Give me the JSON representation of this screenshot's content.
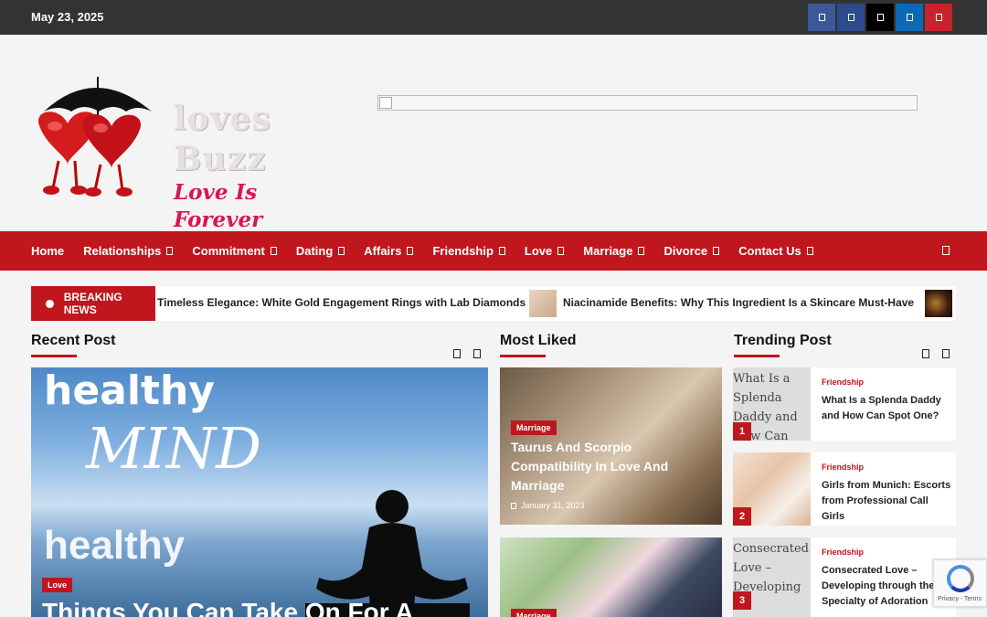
{
  "topbar": {
    "date": "May 23, 2025"
  },
  "socials": [
    {
      "icon": "facebook-icon",
      "color": "#3b5998"
    },
    {
      "icon": "vk-icon",
      "color": "#2d4a8a"
    },
    {
      "icon": "x-twitter-icon",
      "color": "#000000"
    },
    {
      "icon": "linkedin-icon",
      "color": "#0a6ab5"
    },
    {
      "icon": "pinterest-icon",
      "color": "#c8232c"
    }
  ],
  "brand": {
    "name": "loves Buzz",
    "tagline": "Love Is Forever"
  },
  "nav": {
    "items": [
      {
        "label": "Home",
        "dropdown": false
      },
      {
        "label": "Relationships",
        "dropdown": true
      },
      {
        "label": "Commitment",
        "dropdown": true
      },
      {
        "label": "Dating",
        "dropdown": true
      },
      {
        "label": "Affairs",
        "dropdown": true
      },
      {
        "label": "Friendship",
        "dropdown": true
      },
      {
        "label": "Love",
        "dropdown": true
      },
      {
        "label": "Marriage",
        "dropdown": true
      },
      {
        "label": "Divorce",
        "dropdown": true
      },
      {
        "label": "Contact Us",
        "dropdown": true
      }
    ]
  },
  "ticker": {
    "label": "BREAKING NEWS",
    "items": [
      "Timeless Elegance: White Gold Engagement Rings with Lab Diamonds",
      "Niacinamide Benefits: Why This Ingredient Is a Skincare Must-Have"
    ]
  },
  "recent": {
    "title": "Recent Post",
    "post": {
      "category": "Love",
      "title": "Things You Can Take On For A",
      "image_words": [
        "healthy",
        "MIND",
        "healthy"
      ]
    }
  },
  "liked": {
    "title": "Most Liked",
    "posts": [
      {
        "category": "Marriage",
        "title": "Taurus And Scorpio Compatibility In Love And Marriage",
        "date": "January 31, 2023"
      },
      {
        "category": "Marriage"
      }
    ]
  },
  "trending": {
    "title": "Trending Post",
    "posts": [
      {
        "num": "1",
        "alt": "What Is a Splenda Daddy and How Can",
        "category": "Friendship",
        "title": "What Is a Splenda Daddy and How Can Spot One?"
      },
      {
        "num": "2",
        "alt": "",
        "category": "Friendship",
        "title": "Girls from Munich: Escorts from Professional Call Girls"
      },
      {
        "num": "3",
        "alt": "Consecrated Love – Developing",
        "category": "Friendship",
        "title": "Consecrated Love – Developing through the Specialty of Adoration"
      }
    ]
  },
  "recaptcha": {
    "text": "Privacy - Terms"
  },
  "colors": {
    "accent": "#c0161d",
    "topbar": "#333333",
    "brand_pink": "#d81458"
  }
}
